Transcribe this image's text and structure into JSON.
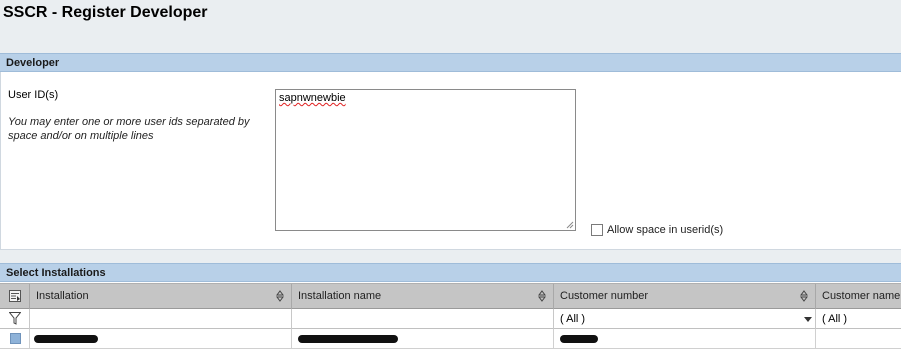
{
  "page": {
    "title": "SSCR - Register Developer"
  },
  "developer_section": {
    "header": "Developer",
    "userid_label": "User ID(s)",
    "help_text": "You may enter one or more user ids separated by space and/or on multiple lines",
    "userid_value": "sapnwnewbie",
    "allow_space_label": "Allow space in userid(s)",
    "allow_space_checked": false
  },
  "installations_section": {
    "header": "Select Installations",
    "columns": [
      {
        "label": "Installation",
        "filter": ""
      },
      {
        "label": "Installation name",
        "filter": ""
      },
      {
        "label": "Customer number",
        "filter": "( All )"
      },
      {
        "label": "Customer name",
        "filter": "( All )"
      }
    ],
    "rows": [
      {
        "installation": "[redacted]",
        "installation_name": "[redacted]",
        "customer_number": "[redacted]",
        "customer_name": ""
      }
    ]
  },
  "colors": {
    "section_header_bg": "#b8d0e8",
    "page_bg": "#eaeef1",
    "table_header_bg": "#c5c5c5",
    "selection_marker": "#8eb2d8"
  }
}
